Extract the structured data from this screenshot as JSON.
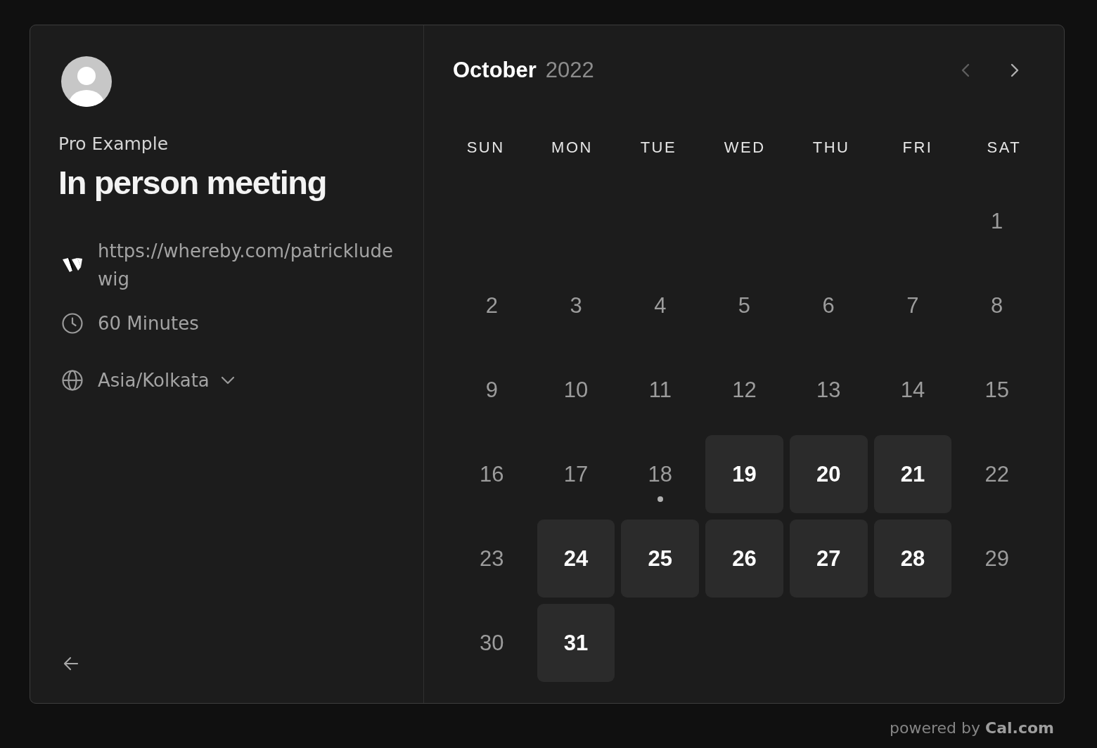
{
  "profile": {
    "name": "Pro Example"
  },
  "event": {
    "title": "In person meeting",
    "details": [
      {
        "kind": "location",
        "text": "https://whereby.com/patrickludewig"
      },
      {
        "kind": "duration",
        "text": "60 Minutes"
      },
      {
        "kind": "timezone",
        "text": "Asia/Kolkata"
      }
    ]
  },
  "calendar": {
    "month": "October",
    "year": "2022",
    "nav_buttons": [
      {
        "kind": "prev",
        "disabled": true
      },
      {
        "kind": "next",
        "disabled": false
      }
    ],
    "weekdays": [
      "SUN",
      "MON",
      "TUE",
      "WED",
      "THU",
      "FRI",
      "SAT"
    ],
    "weeks": [
      [
        {
          "day": "1",
          "available": false,
          "today": false
        }
      ],
      [
        {
          "day": "2",
          "available": false,
          "today": false
        },
        {
          "day": "3",
          "available": false,
          "today": false
        },
        {
          "day": "4",
          "available": false,
          "today": false
        },
        {
          "day": "5",
          "available": false,
          "today": false
        },
        {
          "day": "6",
          "available": false,
          "today": false
        },
        {
          "day": "7",
          "available": false,
          "today": false
        },
        {
          "day": "8",
          "available": false,
          "today": false
        }
      ],
      [
        {
          "day": "9",
          "available": false,
          "today": false
        },
        {
          "day": "10",
          "available": false,
          "today": false
        },
        {
          "day": "11",
          "available": false,
          "today": false
        },
        {
          "day": "12",
          "available": false,
          "today": false
        },
        {
          "day": "13",
          "available": false,
          "today": false
        },
        {
          "day": "14",
          "available": false,
          "today": false
        },
        {
          "day": "15",
          "available": false,
          "today": false
        }
      ],
      [
        {
          "day": "16",
          "available": false,
          "today": false
        },
        {
          "day": "17",
          "available": false,
          "today": false
        },
        {
          "day": "18",
          "available": false,
          "today": true
        },
        {
          "day": "19",
          "available": true,
          "today": false
        },
        {
          "day": "20",
          "available": true,
          "today": false
        },
        {
          "day": "21",
          "available": true,
          "today": false
        },
        {
          "day": "22",
          "available": false,
          "today": false
        }
      ],
      [
        {
          "day": "23",
          "available": false,
          "today": false
        },
        {
          "day": "24",
          "available": true,
          "today": false
        },
        {
          "day": "25",
          "available": true,
          "today": false
        },
        {
          "day": "26",
          "available": true,
          "today": false
        },
        {
          "day": "27",
          "available": true,
          "today": false
        },
        {
          "day": "28",
          "available": true,
          "today": false
        },
        {
          "day": "29",
          "available": false,
          "today": false
        }
      ],
      [
        {
          "day": "30",
          "available": false,
          "today": false
        },
        {
          "day": "31",
          "available": true,
          "today": false
        }
      ]
    ]
  },
  "footer": {
    "text": "powered by **Cal.com**"
  }
}
